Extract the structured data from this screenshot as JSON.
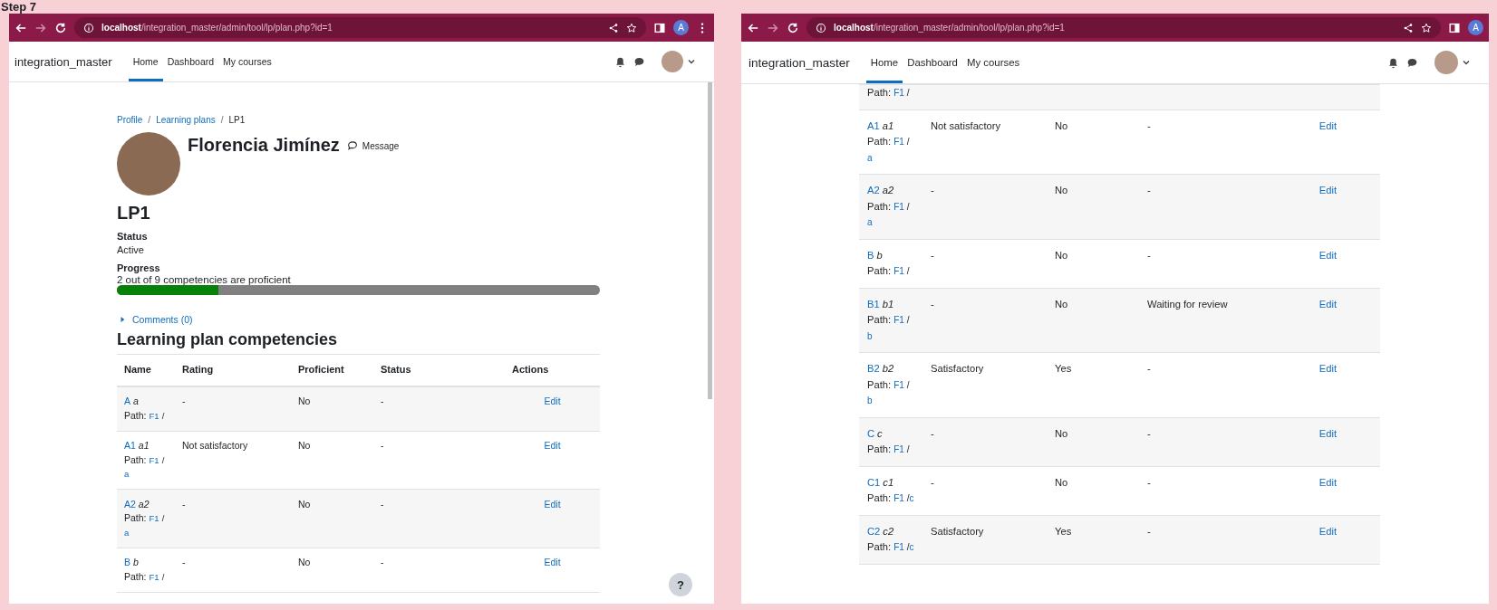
{
  "page_label": "Step 7",
  "windows": [
    {
      "browser": {
        "url_host": "localhost",
        "url_path": "/integration_master/admin/tool/lp/plan.php?id=1",
        "profile_initial": "A",
        "menu": true
      },
      "navbar": {
        "site_name": "integration_master",
        "links": [
          {
            "label": "Home",
            "selected": true
          },
          {
            "label": "Dashboard",
            "selected": false
          },
          {
            "label": "My courses",
            "selected": false
          }
        ]
      },
      "show_scrollbar": true,
      "breadcrumb": [
        {
          "text": "Profile",
          "kind": "link"
        },
        {
          "text": "/",
          "kind": "sep"
        },
        {
          "text": "Learning plans",
          "kind": "link"
        },
        {
          "text": "/",
          "kind": "sep"
        },
        {
          "text": "LP1",
          "kind": "current"
        }
      ],
      "user": {
        "name": "Florencia Jimínez",
        "message_label": "Message"
      },
      "plan": {
        "title": "LP1",
        "status_label": "Status",
        "status": "Active",
        "progress_label": "Progress",
        "progress_text": "2 out of 9 competencies are proficient",
        "level": 0.21
      },
      "comments": {
        "label": "Comments (0)",
        "expanded": false
      },
      "section_title": "Learning plan competencies",
      "table": {
        "columns": [
          "Name",
          "Rating",
          "Proficient",
          "Status",
          "Actions"
        ],
        "rows": [
          {
            "code": "A",
            "name": "a",
            "path_label": "Path:",
            "path": [
              {
                "text": "F1",
                "kind": "link"
              },
              {
                "text": "/",
                "kind": "sep"
              }
            ],
            "rating": "-",
            "proficient": "No",
            "status": "-",
            "action": "Edit"
          },
          {
            "code": "A1",
            "name": "a1",
            "path_label": "Path:",
            "path": [
              {
                "text": "F1",
                "kind": "link"
              },
              {
                "text": "/",
                "kind": "sep"
              },
              {
                "text": "a",
                "kind": "link"
              }
            ],
            "rating": "Not satisfactory",
            "proficient": "No",
            "status": "-",
            "action": "Edit"
          },
          {
            "code": "A2",
            "name": "a2",
            "path_label": "Path:",
            "path": [
              {
                "text": "F1",
                "kind": "link"
              },
              {
                "text": "/",
                "kind": "sep"
              },
              {
                "text": "a",
                "kind": "link"
              }
            ],
            "rating": "-",
            "proficient": "No",
            "status": "-",
            "action": "Edit"
          },
          {
            "code": "B",
            "name": "b",
            "path_label": "Path:",
            "path": [
              {
                "text": "F1",
                "kind": "link"
              },
              {
                "text": "/",
                "kind": "sep"
              }
            ],
            "rating": "-",
            "proficient": "No",
            "status": "-",
            "action": "Edit"
          }
        ]
      },
      "help_button": "?"
    },
    {
      "browser": {
        "url_host": "localhost",
        "url_path": "/integration_master/admin/tool/lp/plan.php?id=1",
        "profile_initial": "A",
        "menu": false
      },
      "navbar": {
        "site_name": "integration_master",
        "links": [
          {
            "label": "Home",
            "selected": true
          },
          {
            "label": "Dashboard",
            "selected": false
          },
          {
            "label": "My courses",
            "selected": false
          }
        ]
      },
      "table": {
        "rows": [
          {
            "path_label": "Path:",
            "path": [
              {
                "text": "F1",
                "kind": "link"
              },
              {
                "text": "/",
                "kind": "sep"
              }
            ]
          },
          {
            "code": "A1",
            "name": "a1",
            "path_label": "Path:",
            "path": [
              {
                "text": "F1",
                "kind": "link"
              },
              {
                "text": "/",
                "kind": "sep"
              },
              {
                "text": "a",
                "kind": "link"
              }
            ],
            "rating": "Not satisfactory",
            "proficient": "No",
            "status": "-",
            "action": "Edit"
          },
          {
            "code": "A2",
            "name": "a2",
            "path_label": "Path:",
            "path": [
              {
                "text": "F1",
                "kind": "link"
              },
              {
                "text": "/",
                "kind": "sep"
              },
              {
                "text": "a",
                "kind": "link"
              }
            ],
            "rating": "-",
            "proficient": "No",
            "status": "-",
            "action": "Edit"
          },
          {
            "code": "B",
            "name": "b",
            "path_label": "Path:",
            "path": [
              {
                "text": "F1",
                "kind": "link"
              },
              {
                "text": "/",
                "kind": "sep"
              }
            ],
            "rating": "-",
            "proficient": "No",
            "status": "-",
            "action": "Edit"
          },
          {
            "code": "B1",
            "name": "b1",
            "path_label": "Path:",
            "path": [
              {
                "text": "F1",
                "kind": "link"
              },
              {
                "text": "/",
                "kind": "sep"
              },
              {
                "text": "b",
                "kind": "link"
              }
            ],
            "rating": "-",
            "proficient": "No",
            "status": "Waiting for review",
            "action": "Edit"
          },
          {
            "code": "B2",
            "name": "b2",
            "path_label": "Path:",
            "path": [
              {
                "text": "F1",
                "kind": "link"
              },
              {
                "text": "/",
                "kind": "sep"
              },
              {
                "text": "b",
                "kind": "link"
              }
            ],
            "rating": "Satisfactory",
            "proficient": "Yes",
            "status": "-",
            "action": "Edit"
          },
          {
            "code": "C",
            "name": "c",
            "path_label": "Path:",
            "path": [
              {
                "text": "F1",
                "kind": "link"
              },
              {
                "text": "/",
                "kind": "sep"
              }
            ],
            "rating": "-",
            "proficient": "No",
            "status": "-",
            "action": "Edit"
          },
          {
            "code": "C1",
            "name": "c1",
            "path_label": "Path:",
            "path": [
              {
                "text": "F1",
                "kind": "link"
              },
              {
                "text": "/",
                "kind": "sep"
              },
              {
                "text": "c",
                "kind": "link"
              }
            ],
            "rating": "-",
            "proficient": "No",
            "status": "-",
            "action": "Edit"
          },
          {
            "code": "C2",
            "name": "c2",
            "path_label": "Path:",
            "path": [
              {
                "text": "F1",
                "kind": "link"
              },
              {
                "text": "/",
                "kind": "sep"
              },
              {
                "text": "c",
                "kind": "link"
              }
            ],
            "rating": "Satisfactory",
            "proficient": "Yes",
            "status": "-",
            "action": "Edit"
          }
        ]
      }
    }
  ]
}
